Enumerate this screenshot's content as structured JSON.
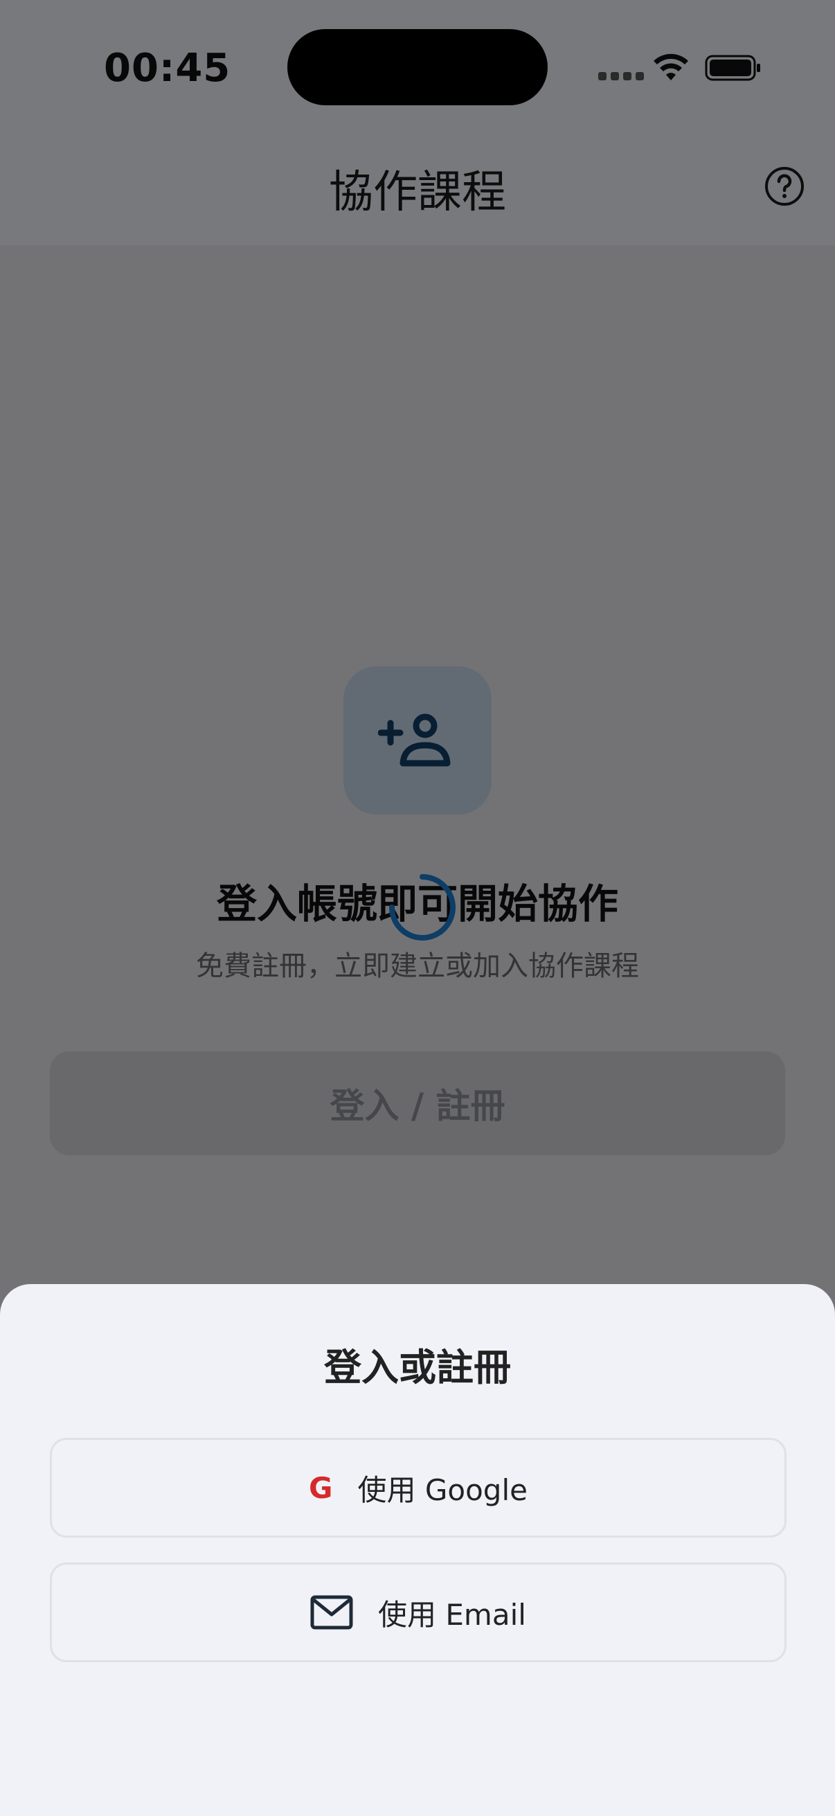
{
  "status_bar": {
    "time": "00:45"
  },
  "header": {
    "title": "協作課程",
    "help_icon": "help-circle-icon"
  },
  "empty_state": {
    "icon": "person-add-icon",
    "title": "登入帳號即可開始協作",
    "subtitle": "免費註冊，立即建立或加入協作課程",
    "login_button": "登入 / 註冊"
  },
  "loading": {
    "icon": "spinner-icon"
  },
  "sheet": {
    "title": "登入或註冊",
    "options": [
      {
        "icon": "google-icon",
        "glyph": "G",
        "label": "使用 Google"
      },
      {
        "icon": "mail-icon",
        "label": "使用 Email"
      }
    ]
  },
  "colors": {
    "accent": "#0e3d66",
    "google_red": "#d62a2a",
    "sheet_bg": "#f1f2f8"
  }
}
